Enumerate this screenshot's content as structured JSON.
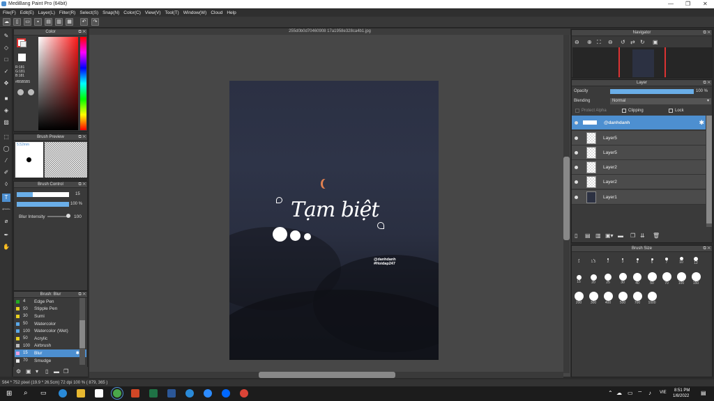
{
  "app": {
    "title": "MediBang Paint Pro (64bit)"
  },
  "menu": [
    "File(F)",
    "Edit(E)",
    "Layer(L)",
    "Filter(R)",
    "Select(S)",
    "Snap(N)",
    "Color(C)",
    "View(V)",
    "Tool(T)",
    "Window(W)",
    "Cloud",
    "Help"
  ],
  "panels": {
    "color": "Color",
    "brush_preview": "Brush Preview",
    "brush_control": "Brush Control",
    "brush_list": "Brush: Blur",
    "navigator": "Navigator",
    "layer": "Layer",
    "brush_size": "Brush Size"
  },
  "color": {
    "r": "R:181",
    "g": "G:181",
    "b": "B:181",
    "hex": "#B5B5B5"
  },
  "brush_preview": {
    "size": "5.52mm"
  },
  "brush_control": {
    "size": "15",
    "opacity": "100 %",
    "blur_label": "Blur Intensity",
    "blur_value": "100"
  },
  "brushes": [
    {
      "n": "4",
      "name": "Edge Pen",
      "color": "#22aa22"
    },
    {
      "n": "50",
      "name": "Stipple Pen",
      "color": "#e8d020"
    },
    {
      "n": "30",
      "name": "Sumi",
      "color": "#e8d020"
    },
    {
      "n": "50",
      "name": "Watercolor",
      "color": "#5aa8e8"
    },
    {
      "n": "100",
      "name": "Watercolor (Wet)",
      "color": "#5aa8e8"
    },
    {
      "n": "50",
      "name": "Acrylic",
      "color": "#e8d020"
    },
    {
      "n": "100",
      "name": "Airbrush",
      "color": "#bbbbbb"
    },
    {
      "n": "15",
      "name": "Blur",
      "color": "#e8a0e0"
    },
    {
      "n": "70",
      "name": "Smudge",
      "color": "#e8e8e8"
    }
  ],
  "document": {
    "filename": "255d0b0d70460908 17a1958e328ca4b1.jpg"
  },
  "artwork": {
    "title": "Tạm biệt",
    "handle": "@danhdanh",
    "tag": "#Hoidap247"
  },
  "layer_panel": {
    "opacity_label": "Opacity",
    "opacity_value": "100 %",
    "blending_label": "Blending",
    "blending_value": "Normal",
    "protect_alpha": "Protect Alpha",
    "clipping": "Clipping",
    "lock": "Lock"
  },
  "layers": [
    "@danhdanh",
    "Layer5",
    "Layer5",
    "Layer2",
    "Layer2",
    "Layer1"
  ],
  "brush_sizes": [
    "1",
    "1.5",
    "2",
    "3",
    "4",
    "5",
    "7",
    "10",
    "12",
    "15",
    "20",
    "25",
    "30",
    "40",
    "50",
    "70",
    "100",
    "150",
    "200",
    "300",
    "400",
    "500",
    "700",
    "1000"
  ],
  "status": {
    "text": "564 * 752 pixel  (19.9 * 26.5cm)  72 dpi  100 %  ( 879, 365 )"
  },
  "taskbar": {
    "time": "8:51 PM",
    "date": "1/8/2022",
    "lang": "VIE"
  }
}
